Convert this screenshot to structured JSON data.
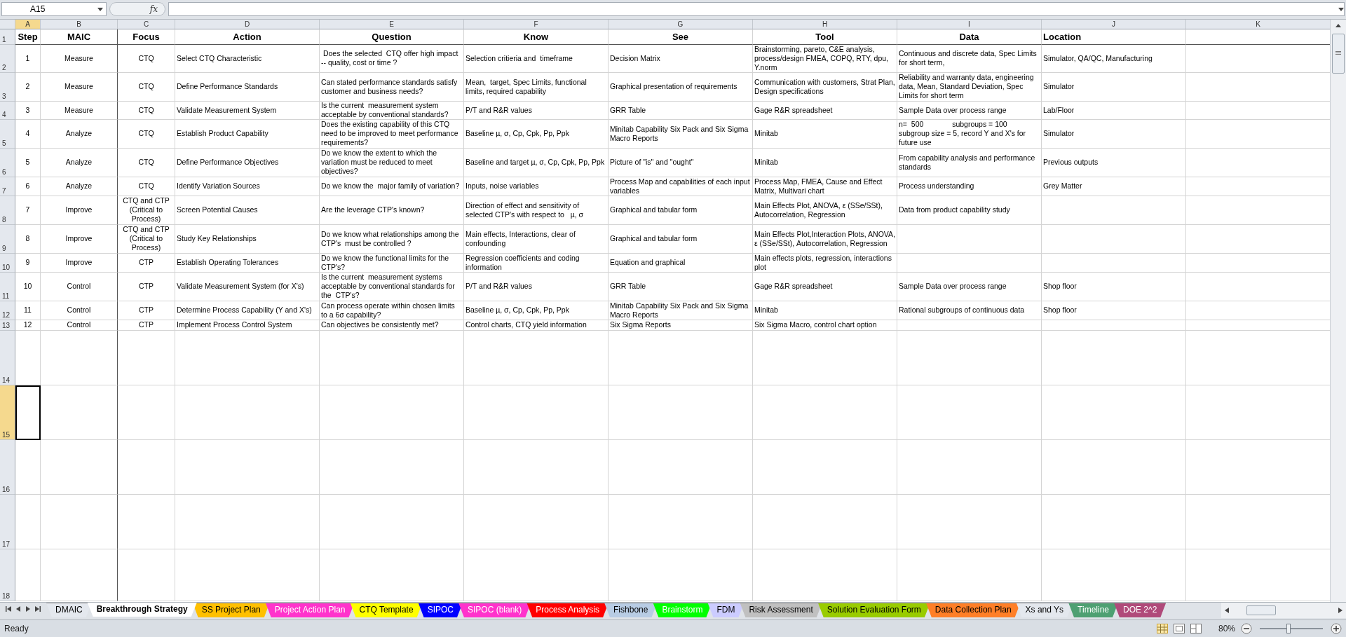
{
  "formula_bar": {
    "name_box": "A15",
    "function_label": "fx"
  },
  "columns": [
    {
      "letter": "A",
      "selected": true
    },
    {
      "letter": "B",
      "selected": false
    },
    {
      "letter": "C",
      "selected": false
    },
    {
      "letter": "D",
      "selected": false
    },
    {
      "letter": "E",
      "selected": false
    },
    {
      "letter": "F",
      "selected": false
    },
    {
      "letter": "G",
      "selected": false
    },
    {
      "letter": "H",
      "selected": false
    },
    {
      "letter": "I",
      "selected": false
    },
    {
      "letter": "J",
      "selected": false
    },
    {
      "letter": "K",
      "selected": false
    }
  ],
  "row_headers": [
    {
      "label": "1",
      "selected": false
    },
    {
      "label": "2",
      "selected": false
    },
    {
      "label": "3",
      "selected": false
    },
    {
      "label": "4",
      "selected": false
    },
    {
      "label": "5",
      "selected": false
    },
    {
      "label": "6",
      "selected": false
    },
    {
      "label": "7",
      "selected": false
    },
    {
      "label": "8",
      "selected": false
    },
    {
      "label": "9",
      "selected": false
    },
    {
      "label": "10",
      "selected": false
    },
    {
      "label": "11",
      "selected": false
    },
    {
      "label": "12",
      "selected": false
    },
    {
      "label": "13",
      "selected": false
    },
    {
      "label": "14",
      "selected": false
    },
    {
      "label": "15",
      "selected": true
    },
    {
      "label": "16",
      "selected": false
    },
    {
      "label": "17",
      "selected": false
    },
    {
      "label": "18",
      "selected": false
    }
  ],
  "header": {
    "step": "Step",
    "maic": "MAIC",
    "focus": "Focus",
    "action": "Action",
    "question": "Question",
    "know": "Know",
    "see": "See",
    "tool": "Tool",
    "data": "Data",
    "location": "Location"
  },
  "rows": [
    {
      "step": "1",
      "maic": "Measure",
      "focus": "CTQ",
      "action": "Select CTQ Characteristic",
      "question": " Does the selected  CTQ offer high impact -- quality, cost or time ?",
      "know": "Selection critieria and  timeframe",
      "see": "Decision Matrix",
      "tool": "Brainstorming, pareto, C&E analysis, process/design FMEA, COPQ, RTY, dpu, Y.norm",
      "data": "Continuous and discrete data, Spec Limits for short term,",
      "location": "Simulator, QA/QC, Manufacturing"
    },
    {
      "step": "2",
      "maic": "Measure",
      "focus": "CTQ",
      "action": "Define Performance Standards",
      "question": "Can stated performance standards satisfy customer and business needs?",
      "know": "Mean,  target, Spec Limits, functional limits, required capability",
      "see": "Graphical presentation of requirements",
      "tool": "Communication with customers, Strat Plan, Design specifications",
      "data": "Reliability and warranty data, engineering data, Mean, Standard Deviation, Spec Limits for short term",
      "location": "Simulator"
    },
    {
      "step": "3",
      "maic": "Measure",
      "focus": "CTQ",
      "action": "Validate Measurement System",
      "question": "Is the current  measurement system acceptable by conventional standards?",
      "know": "P/T and R&R values",
      "see": "GRR Table",
      "tool": "Gage R&R spreadsheet",
      "data": "Sample Data over process range",
      "location": "Lab/Floor"
    },
    {
      "step": "4",
      "maic": "Analyze",
      "focus": "CTQ",
      "action": "Establish Product Capability",
      "question": "Does the existing capability of this CTQ need to be improved to meet performance requirements?",
      "know": "Baseline µ, σ, Cp, Cpk, Pp, Ppk",
      "see": "Minitab Capability Six Pack and Six Sigma Macro Reports",
      "tool": "Minitab",
      "data": "n=  500              subgroups = 100 subgroup size = 5, record Y and X's for future use",
      "location": "Simulator"
    },
    {
      "step": "5",
      "maic": "Analyze",
      "focus": "CTQ",
      "action": "Define Performance Objectives",
      "question": "Do we know the extent to which the variation must be reduced to meet objectives?",
      "know": "Baseline and target µ, σ, Cp, Cpk, Pp, Ppk",
      "see": "Picture of \"is\" and \"ought\"",
      "tool": "Minitab",
      "data": "From capability analysis and performance standards",
      "location": "Previous outputs"
    },
    {
      "step": "6",
      "maic": "Analyze",
      "focus": "CTQ",
      "action": "Identify Variation Sources",
      "question": "Do we know the  major family of variation?",
      "know": "Inputs, noise variables",
      "see": "Process Map and capabilities of each input variables",
      "tool": "Process Map, FMEA, Cause and Effect Matrix, Multivari chart",
      "data": "Process understanding",
      "location": "Grey Matter"
    },
    {
      "step": "7",
      "maic": "Improve",
      "focus": "CTQ and CTP (Critical to Process)",
      "action": "Screen Potential Causes",
      "question": "Are the leverage CTP's known?",
      "know": "Direction of effect and sensitivity of selected CTP's with respect to   µ, σ",
      "see": "Graphical and tabular form",
      "tool": "Main Effects Plot, ANOVA, ε (SSe/SSt), Autocorrelation, Regression",
      "data": "Data from product capability study"
    },
    {
      "step": "8",
      "maic": "Improve",
      "focus": "CTQ and CTP (Critical to Process)",
      "action": "Study Key Relationships",
      "question": "Do we know what relationships among the CTP's  must be controlled ?",
      "know": "Main effects, Interactions, clear of confounding",
      "see": "Graphical and tabular form",
      "tool": "Main Effects Plot,Interaction Plots, ANOVA, ε (SSe/SSt), Autocorrelation, Regression"
    },
    {
      "step": "9",
      "maic": "Improve",
      "focus": "CTP",
      "action": "Establish Operating Tolerances",
      "question": "Do we know the functional limits for the CTP's?",
      "know": "Regression coefficients and coding information",
      "see": "Equation and graphical",
      "tool": "Main effects plots, regression, interactions plot"
    },
    {
      "step": "10",
      "maic": "Control",
      "focus": "CTP",
      "action": "Validate Measurement System (for X's)",
      "question": "Is the current  measurement systems acceptable by conventional standards for the  CTP's?",
      "know": "P/T and R&R values",
      "see": "GRR Table",
      "tool": "Gage R&R spreadsheet",
      "data": "Sample Data over process range",
      "location": "Shop floor"
    },
    {
      "step": "11",
      "maic": "Control",
      "focus": "CTP",
      "action": "Determine Process Capability (Y and X's)",
      "question": "Can process operate within chosen limits to a 6σ capability?",
      "know": "Baseline µ, σ, Cp, Cpk, Pp, Ppk",
      "see": "Minitab Capability Six Pack and Six Sigma Macro Reports",
      "tool": "Minitab",
      "data": "Rational subgroups of continuous data",
      "location": "Shop floor"
    },
    {
      "step": "12",
      "maic": "Control",
      "focus": "CTP",
      "action": "Implement Process Control System",
      "question": "Can objectives be consistently met?",
      "know": "Control charts, CTQ yield information",
      "see": "Six Sigma Reports",
      "tool": "Six Sigma Macro, control chart option"
    }
  ],
  "sheet_tabs": [
    {
      "label": "DMAIC",
      "selected": false
    },
    {
      "label": "Breakthrough Strategy",
      "selected": true
    },
    {
      "label": "SS Project Plan",
      "selected": false,
      "color": "#ffc000"
    },
    {
      "label": "Project Action Plan",
      "selected": false,
      "color": "#ff33cc"
    },
    {
      "label": "CTQ Template",
      "selected": false,
      "color": "#ffff00"
    },
    {
      "label": "SIPOC",
      "selected": false,
      "color": "#0000ff"
    },
    {
      "label": "SIPOC (blank)",
      "selected": false,
      "color": "#ff33cc"
    },
    {
      "label": "Process Analysis",
      "selected": false,
      "color": "#ff0000"
    },
    {
      "label": "Fishbone",
      "selected": false,
      "color": "#b8cce4"
    },
    {
      "label": "Brainstorm",
      "selected": false,
      "color": "#00ff00"
    },
    {
      "label": "FDM",
      "selected": false,
      "color": "#ccccff"
    },
    {
      "label": "Risk Assessment",
      "selected": false,
      "color": "#c0c0c0"
    },
    {
      "label": "Solution Evaluation Form",
      "selected": false,
      "color": "#99cc00"
    },
    {
      "label": "Data Collection Plan",
      "selected": false,
      "color": "#ff7f27"
    },
    {
      "label": "Xs and Ys",
      "selected": false
    },
    {
      "label": "Timeline",
      "selected": false,
      "color": "#4ea072"
    },
    {
      "label": "DOE 2^2",
      "selected": false,
      "color": "#b04a7a"
    }
  ],
  "status_bar": {
    "status": "Ready",
    "zoom": "80%",
    "zoom_slider": {
      "level": 0.45
    }
  }
}
